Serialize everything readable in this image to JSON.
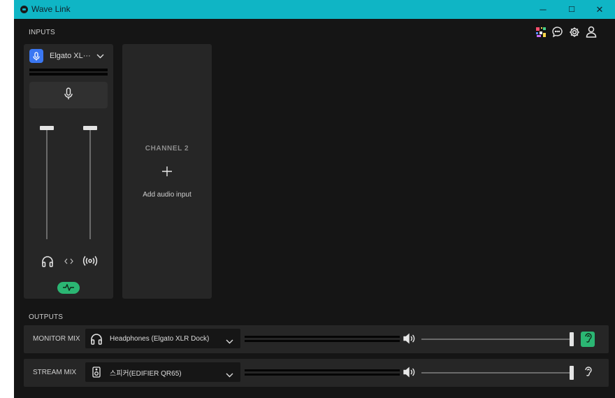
{
  "window": {
    "title": "Wave Link",
    "minimize": "─",
    "maximize": "☐",
    "close": "✕"
  },
  "inputs": {
    "section_label": "INPUTS",
    "channel1": {
      "name": "Elgato XL···",
      "mic_fader_level": 0.0,
      "stream_fader_level": 0.0
    },
    "channel2": {
      "label": "CHANNEL 2",
      "add_label": "Add audio input"
    }
  },
  "outputs": {
    "section_label": "OUTPUTS",
    "monitor": {
      "label": "MONITOR MIX",
      "device": "Headphones (Elgato XLR Dock)",
      "volume": 1.0,
      "listening": true
    },
    "stream": {
      "label": "STREAM MIX",
      "device": "스피커(EDIFIER QR65)",
      "volume": 1.0,
      "listening": false
    }
  },
  "colors": {
    "accent": "#0fb5c5",
    "green": "#2bb673",
    "mic_badge": "#3a77f2"
  },
  "icons": [
    "multicolor-app-icon",
    "feedback-chat-icon",
    "gear-icon",
    "user-icon"
  ]
}
